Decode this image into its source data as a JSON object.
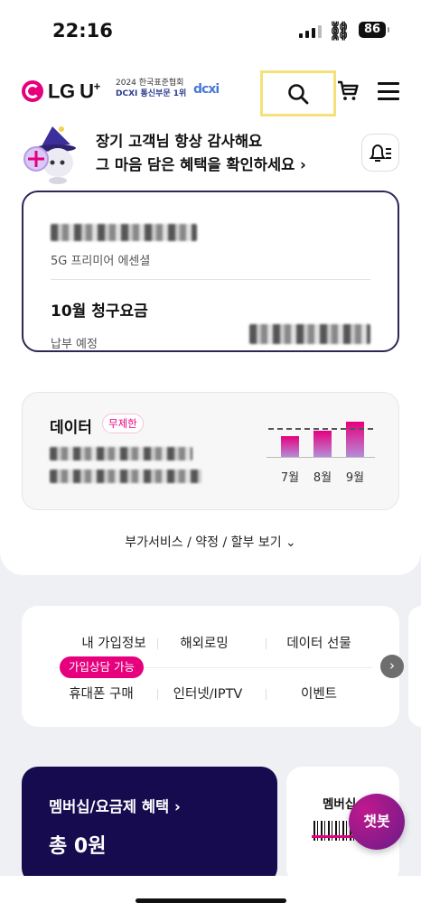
{
  "status_bar": {
    "time": "22:16",
    "battery": "86"
  },
  "header": {
    "brand": "LG U",
    "brand_plus": "+",
    "award_line1": "2024 한국표준협회",
    "award_line2": "DCXI 통신부문 1위",
    "award_mark": "dcxi",
    "icons": [
      "search-icon",
      "cart-icon",
      "menu-icon"
    ]
  },
  "promo": {
    "line1": "장기 고객님 항상 감사해요",
    "line2": "그 마음 담은 혜택을 확인하세요 ›"
  },
  "plan_card": {
    "plan_name": "5G 프리미어 에센셜",
    "bill_title": "10월 청구요금",
    "bill_sub": "납부 예정"
  },
  "data_card": {
    "title": "데이터",
    "badge": "무제한",
    "months": [
      "7월",
      "8월",
      "9월"
    ],
    "usage_levels": [
      0.45,
      0.55,
      0.75
    ]
  },
  "more_link": "부가서비스 / 약정 / 할부 보기 ⌄",
  "quick_menu": {
    "row1": [
      "내 가입정보",
      "해외로밍",
      "데이터 선물"
    ],
    "row2": [
      "휴대폰 구매",
      "인터넷/IPTV",
      "이벤트"
    ],
    "pill": "가입상담 가능"
  },
  "membership": {
    "label": "멤버십/요금제 혜택 ›",
    "total": "총 0원"
  },
  "member_card": {
    "label": "멤버십"
  },
  "chatbot": "챗봇",
  "colors": {
    "brand_pink": "#e6007e",
    "navy": "#160b4f",
    "highlight": "#f6e07a"
  }
}
